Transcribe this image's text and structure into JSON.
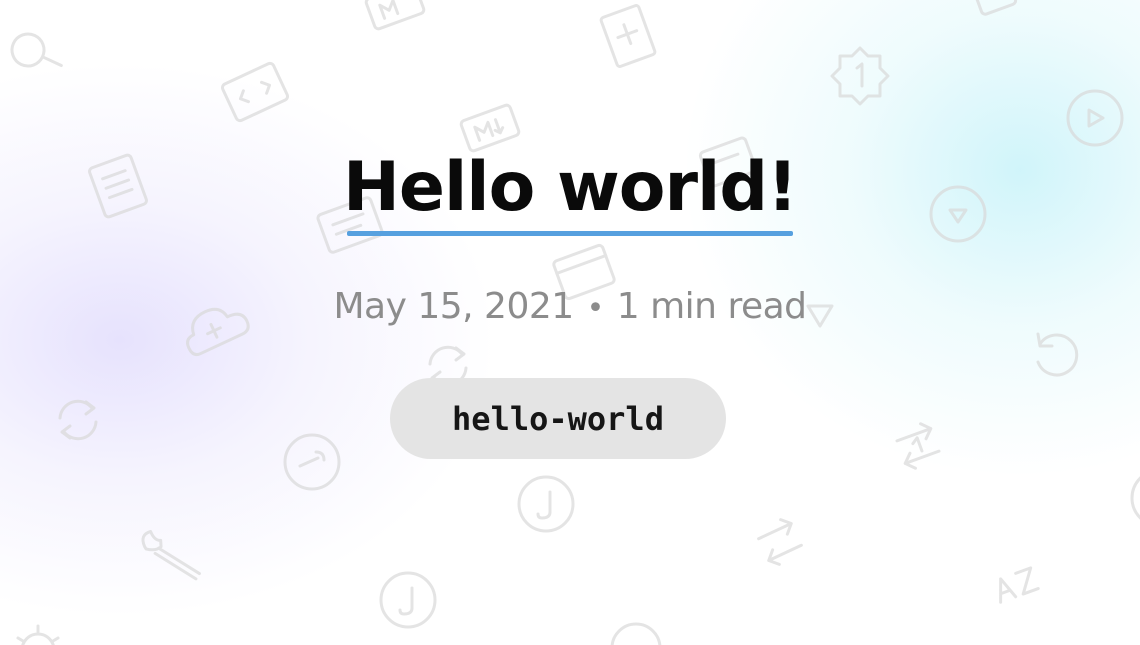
{
  "post": {
    "title": "Hello world!",
    "date": "May 15, 2021",
    "separator": "•",
    "read_time": "1 min read",
    "tag": "hello-world"
  },
  "colors": {
    "title": "#0a0a0a",
    "underline_accent": "#56a0df",
    "meta_text": "#8c8c8c",
    "tag_background": "#e4e4e4",
    "background_glow_left": "#c4bafa",
    "background_glow_right": "#aaecf6"
  },
  "background_icons": [
    "search-icon",
    "code-icon",
    "markdown-icon",
    "document-icon",
    "settings-icon",
    "cloud-icon",
    "refresh-icon",
    "wrench-icon",
    "music-icon",
    "play-icon",
    "undo-icon",
    "sort-az-icon",
    "swap-icon"
  ]
}
